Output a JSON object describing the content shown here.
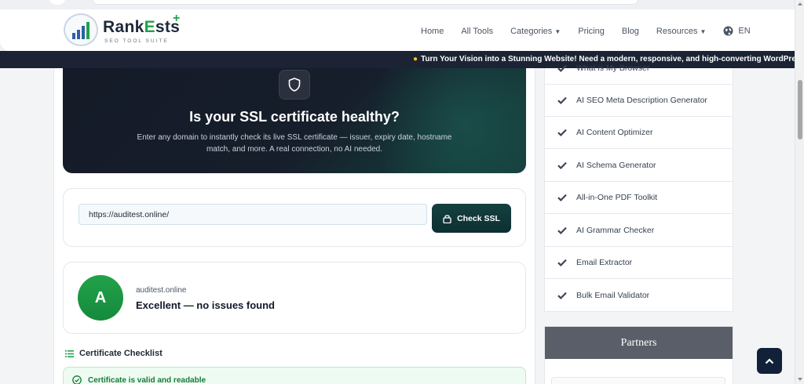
{
  "brand": {
    "name_part1": "Rank",
    "name_part2": "E",
    "name_part3": "sts",
    "tagline": "SEO TOOL SUITE",
    "green": "#22a24a"
  },
  "nav": {
    "items": [
      {
        "label": "Home"
      },
      {
        "label": "All Tools"
      },
      {
        "label": "Categories",
        "has_dropdown": true
      },
      {
        "label": "Pricing"
      },
      {
        "label": "Blog"
      },
      {
        "label": "Resources",
        "has_dropdown": true
      }
    ],
    "language": "EN"
  },
  "ticker": {
    "text": "Turn Your Vision into a Stunning Website! Need a modern, responsive, and high-converting WordPress website"
  },
  "hero": {
    "icon": "shield-icon",
    "title": "Is your SSL certificate healthy?",
    "subtitle": "Enter any domain to instantly check its live SSL certificate — issuer, expiry date, hostname match, and more. A real connection, no AI needed."
  },
  "form": {
    "url_value": "https://auditest.online/",
    "button_label": "Check SSL",
    "button_icon": "lock-icon"
  },
  "result": {
    "grade": "A",
    "domain": "auditest.online",
    "status": "Excellent — no issues found",
    "grade_color": "#22a24a"
  },
  "checklist": {
    "title": "Certificate Checklist",
    "items": [
      {
        "label": "Certificate is valid and readable"
      }
    ]
  },
  "sidebar": {
    "items": [
      {
        "label": "What is My Browser"
      },
      {
        "label": "AI SEO Meta Description Generator"
      },
      {
        "label": "AI Content Optimizer"
      },
      {
        "label": "AI Schema Generator"
      },
      {
        "label": "All-in-One PDF Toolkit"
      },
      {
        "label": "AI Grammar Checker"
      },
      {
        "label": "Email Extractor"
      },
      {
        "label": "Bulk Email Validator"
      }
    ],
    "partners_title": "Partners"
  }
}
